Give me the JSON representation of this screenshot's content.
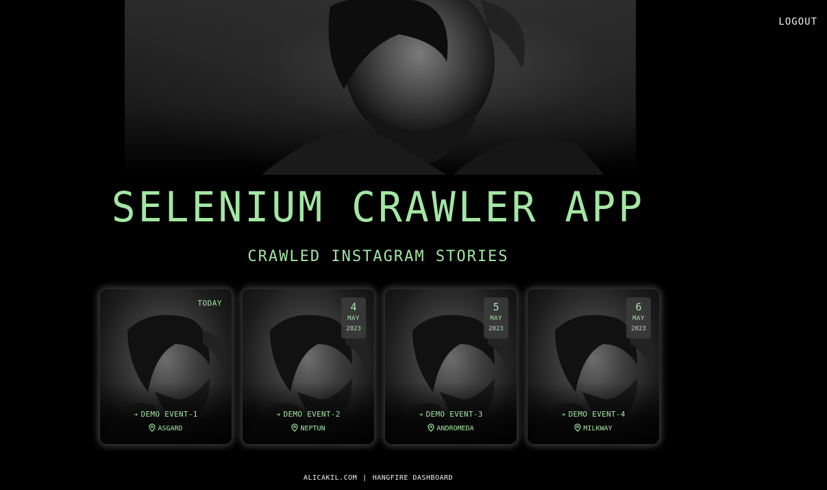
{
  "header": {
    "logout_label": "LOGOUT"
  },
  "hero": {
    "image": "portrait-photo"
  },
  "title": "SELENIUM CRAWLER APP",
  "subtitle": "CRAWLED INSTAGRAM STORIES",
  "cards": [
    {
      "badge_type": "today",
      "today_label": "TODAY",
      "event": "DEMO EVENT-1",
      "location": "ASGARD"
    },
    {
      "badge_type": "date",
      "day": "4",
      "month": "MAY",
      "year": "2023",
      "event": "DEMO EVENT-2",
      "location": "NEPTUN"
    },
    {
      "badge_type": "date",
      "day": "5",
      "month": "MAY",
      "year": "2023",
      "event": "DEMO EVENT-3",
      "location": "ANDROMEDA"
    },
    {
      "badge_type": "date",
      "day": "6",
      "month": "MAY",
      "year": "2023",
      "event": "DEMO EVENT-4",
      "location": "MILKWAY"
    }
  ],
  "footer": {
    "link1": "ALICAKIL.COM",
    "separator": "|",
    "link2": "HANGFIRE DASHBOARD"
  },
  "colors": {
    "accent": "#a3e6a3",
    "background": "#000000",
    "text": "#f2f2f2"
  }
}
